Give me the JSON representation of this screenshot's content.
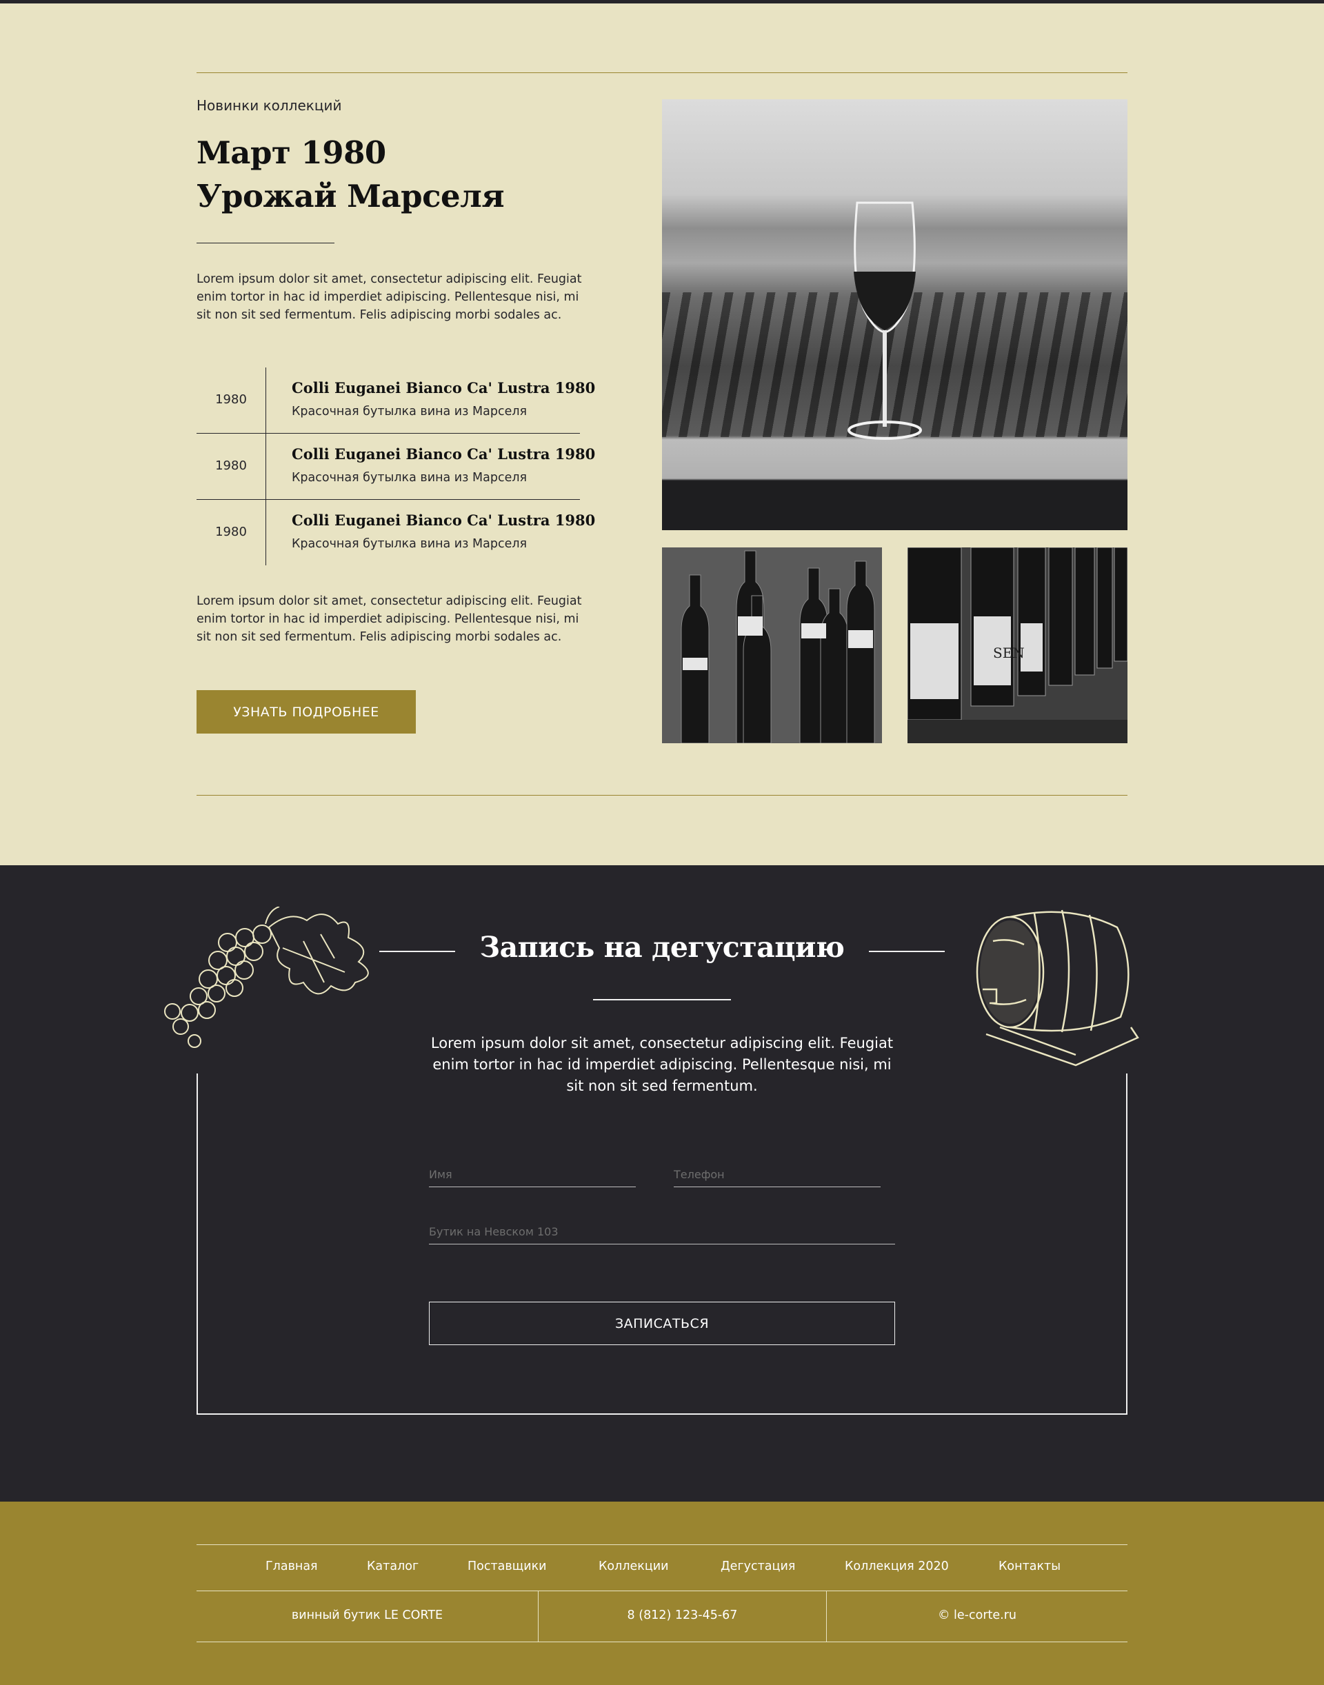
{
  "collection": {
    "kicker": "Новинки коллекций",
    "headline_line1": "Март 1980",
    "headline_line2": "Урожай Марселя",
    "paragraph1": "Lorem ipsum dolor sit amet, consectetur adipiscing elit. Feugiat enim tortor in hac id imperdiet adipiscing. Pellentesque nisi, mi sit non sit sed fermentum. Felis adipiscing morbi sodales ac.",
    "wines": [
      {
        "year": "1980",
        "title": "Colli Euganei Bianco Ca' Lustra 1980",
        "subtitle": "Красочная бутылка вина из Марселя"
      },
      {
        "year": "1980",
        "title": "Colli Euganei Bianco Ca' Lustra 1980",
        "subtitle": "Красочная бутылка вина из Марселя"
      },
      {
        "year": "1980",
        "title": "Colli Euganei Bianco Ca' Lustra 1980",
        "subtitle": "Красочная бутылка вина из Марселя"
      }
    ],
    "paragraph2": "Lorem ipsum dolor sit amet, consectetur adipiscing elit. Feugiat enim tortor in hac id imperdiet adipiscing. Pellentesque nisi, mi sit non sit sed fermentum. Felis adipiscing morbi sodales ac.",
    "more_button": "УЗНАТЬ ПОДРОБНЕЕ",
    "bottle_label": "SEN"
  },
  "tasting": {
    "title": "Запись на дегустацию",
    "text": "Lorem ipsum dolor sit amet, consectetur adipiscing elit. Feugiat enim tortor in hac id imperdiet adipiscing. Pellentesque nisi, mi sit non sit sed fermentum.",
    "name_placeholder": "Имя",
    "phone_placeholder": "Телефон",
    "boutique_placeholder": "Бутик на Невском 103",
    "submit_button": "ЗАПИСАТЬСЯ"
  },
  "footer": {
    "nav": [
      "Главная",
      "Каталог",
      "Поставщики",
      "Коллекции",
      "Дегустация",
      "Коллекция 2020",
      "Контакты"
    ],
    "brand": "винный бутик LE CORTE",
    "phone": "8 (812) 123-45-67",
    "copyright": "© le-corte.ru"
  },
  "colors": {
    "background": "#e8e3c3",
    "accent": "#9a8530",
    "dark": "#26252a"
  }
}
